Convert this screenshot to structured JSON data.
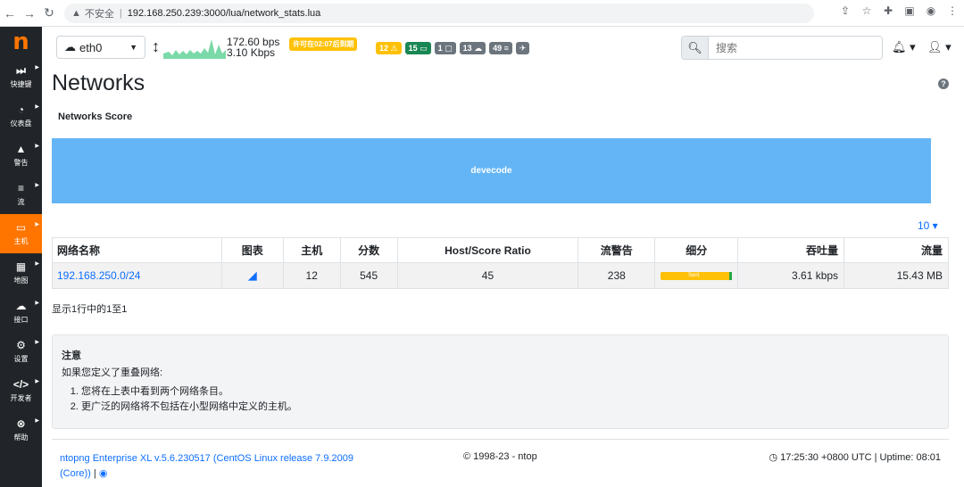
{
  "browser": {
    "back": "←",
    "forward": "→",
    "reload": "↻",
    "warn_icon": "▲",
    "insecure": "不安全",
    "url": "192.168.250.239:3000/lua/network_stats.lua",
    "actions": [
      "⇪",
      "☆",
      "✚",
      "▣",
      "◉",
      "⋮"
    ]
  },
  "sidebar": {
    "logo": "n",
    "items": [
      {
        "icon": "⏭",
        "label": "快捷键",
        "name": "shortcuts"
      },
      {
        "icon": "◔",
        "label": "仪表盘",
        "name": "dashboard"
      },
      {
        "icon": "▲",
        "label": "警告",
        "name": "alerts"
      },
      {
        "icon": "≡",
        "label": "流",
        "name": "flows"
      },
      {
        "icon": "▭",
        "label": "主机",
        "name": "hosts",
        "active": true
      },
      {
        "icon": "▦",
        "label": "地图",
        "name": "maps"
      },
      {
        "icon": "☁",
        "label": "接口",
        "name": "interfaces"
      },
      {
        "icon": "⚙",
        "label": "设置",
        "name": "settings"
      },
      {
        "icon": "</>",
        "label": "开发者",
        "name": "developer"
      },
      {
        "icon": "⊗",
        "label": "帮助",
        "name": "help"
      }
    ]
  },
  "topbar": {
    "interface": "eth0",
    "rate_up": "172.60 bps",
    "rate_down": "3.10 Kbps",
    "license": "许可在02:07后到期",
    "badges": [
      {
        "text": "12 ⚠",
        "color": "yellow"
      },
      {
        "text": "15 ▭",
        "color": "green"
      },
      {
        "text": "1 ▢",
        "color": "gray"
      },
      {
        "text": "13 ☁",
        "color": "gray"
      },
      {
        "text": "49 ≡",
        "color": "gray"
      },
      {
        "text": "✈",
        "color": "gray"
      }
    ],
    "search_placeholder": "搜索"
  },
  "main": {
    "title": "Networks",
    "score_title": "Networks Score",
    "score_block_label": "devecode",
    "per_page": "10 ▾",
    "table": {
      "headers": [
        "网络名称",
        "图表",
        "主机",
        "分数",
        "Host/Score Ratio",
        "流警告",
        "细分",
        "吞吐量",
        "流量"
      ],
      "rows": [
        {
          "network": "192.168.250.0/24",
          "hosts": "12",
          "score": "545",
          "ratio": "45",
          "flow_alerts": "238",
          "breakdown_label": "Sent",
          "throughput": "3.61 kbps",
          "traffic": "15.43 MB"
        }
      ]
    },
    "showing": "显示1行中的1至1",
    "note": {
      "title": "注意",
      "intro": "如果您定义了重叠网络:",
      "items": [
        "您将在上表中看到两个网络条目。",
        "更广泛的网络将不包括在小型网络中定义的主机。"
      ]
    }
  },
  "footer": {
    "version": "ntopng Enterprise XL v.5.6.230517 (CentOS Linux release 7.9.2009 (Core))",
    "github_sep": "|",
    "copyright": "© 1998-23 - ntop",
    "status": "17:25:30 +0800 UTC | Uptime: 08:01"
  },
  "colors": {
    "accent": "#ff7500",
    "sidebar": "#212529",
    "score_block": "#64b5f6",
    "link": "#0d6efd"
  }
}
